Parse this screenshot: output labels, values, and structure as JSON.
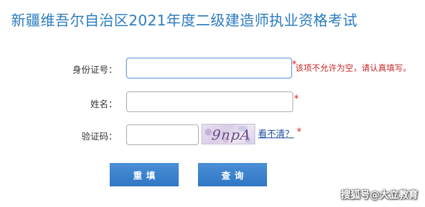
{
  "header": {
    "title": "新疆维吾尔自治区2021年度二级建造师执业资格考试"
  },
  "form": {
    "id_label": "身份证号：",
    "id_value": "",
    "id_required": "*",
    "id_error": "该项不允许为空，请认真填写。",
    "name_label": "姓名：",
    "name_value": "",
    "name_required": "*",
    "captcha_label": "验证码：",
    "captcha_value": "",
    "captcha_image_text": "9npA",
    "captcha_refresh": "看不清？",
    "captcha_required": "*"
  },
  "buttons": {
    "reset": "重填",
    "query": "查询"
  },
  "watermark": "搜狐号@大立教育",
  "colors": {
    "title": "#2b7bbf",
    "button": "#3a82cc",
    "error": "#c62828"
  }
}
